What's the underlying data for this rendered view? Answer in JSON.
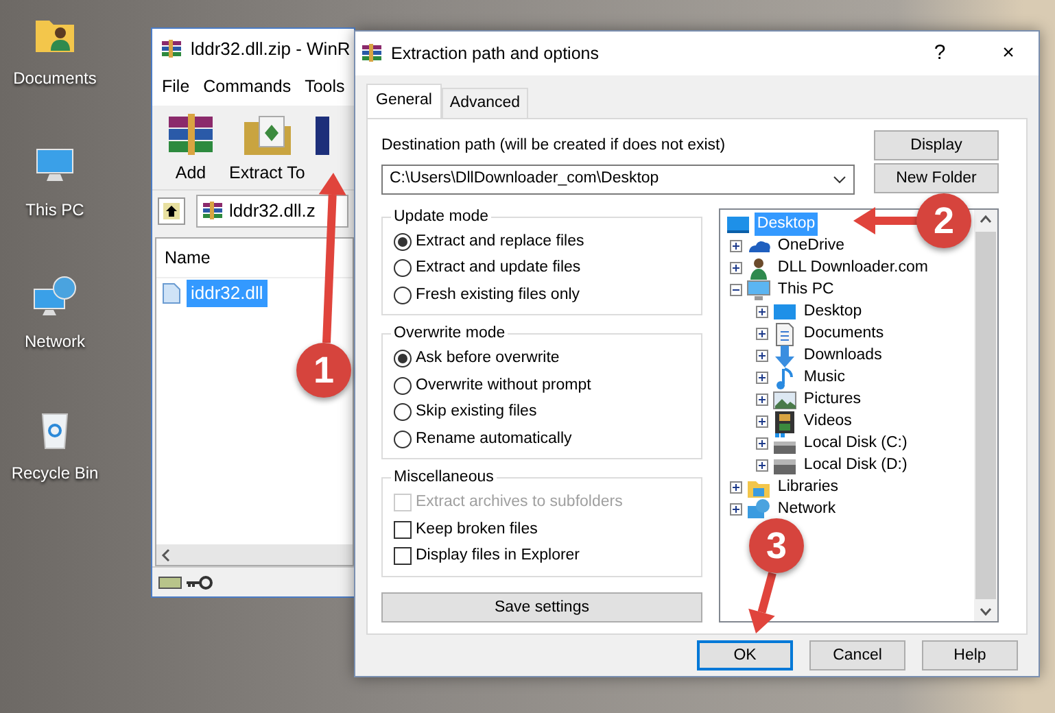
{
  "desktop": {
    "icons": [
      {
        "label": "Documents"
      },
      {
        "label": "This PC"
      },
      {
        "label": "Network"
      },
      {
        "label": "Recycle Bin"
      }
    ]
  },
  "archiver_window": {
    "title": "lddr32.dll.zip - WinR",
    "menu": [
      "File",
      "Commands",
      "Tools"
    ],
    "toolbar": [
      {
        "label": "Add"
      },
      {
        "label": "Extract To"
      }
    ],
    "path": "lddr32.dll.z",
    "list": {
      "columns": [
        "Name"
      ],
      "rows": [
        {
          "name": "iddr32.dll",
          "selected": true
        }
      ]
    }
  },
  "dialog": {
    "title": "Extraction path and options",
    "help": "?",
    "close": "×",
    "tabs": [
      {
        "label": "General",
        "selected": true
      },
      {
        "label": "Advanced",
        "selected": false
      }
    ],
    "destination": {
      "label": "Destination path (will be created if does not exist)",
      "value": "C:\\Users\\DllDownloader_com\\Desktop"
    },
    "side_buttons": [
      "Display",
      "New Folder"
    ],
    "groups": [
      {
        "title": "Update mode",
        "options": [
          {
            "kind": "radio",
            "label": "Extract and replace files",
            "checked": true,
            "disabled": false
          },
          {
            "kind": "radio",
            "label": "Extract and update files",
            "checked": false,
            "disabled": false
          },
          {
            "kind": "radio",
            "label": "Fresh existing files only",
            "checked": false,
            "disabled": false
          }
        ]
      },
      {
        "title": "Overwrite mode",
        "options": [
          {
            "kind": "radio",
            "label": "Ask before overwrite",
            "checked": true,
            "disabled": false
          },
          {
            "kind": "radio",
            "label": "Overwrite without prompt",
            "checked": false,
            "disabled": false
          },
          {
            "kind": "radio",
            "label": "Skip existing files",
            "checked": false,
            "disabled": false
          },
          {
            "kind": "radio",
            "label": "Rename automatically",
            "checked": false,
            "disabled": false
          }
        ]
      },
      {
        "title": "Miscellaneous",
        "options": [
          {
            "kind": "checkbox",
            "label": "Extract archives to subfolders",
            "checked": false,
            "disabled": true
          },
          {
            "kind": "checkbox",
            "label": "Keep broken files",
            "checked": false,
            "disabled": false
          },
          {
            "kind": "checkbox",
            "label": "Display files in Explorer",
            "checked": false,
            "disabled": false
          }
        ]
      }
    ],
    "save_button": "Save settings",
    "tree": [
      {
        "label": "Desktop",
        "selected": true,
        "children": [
          {
            "label": "OneDrive",
            "selected": false,
            "expanded": false
          },
          {
            "label": "DLL Downloader.com",
            "selected": false,
            "expanded": false
          },
          {
            "label": "This PC",
            "selected": false,
            "expanded": true,
            "children": [
              {
                "label": "Desktop",
                "selected": false,
                "expanded": false
              },
              {
                "label": "Documents",
                "selected": false,
                "expanded": false
              },
              {
                "label": "Downloads",
                "selected": false,
                "expanded": false
              },
              {
                "label": "Music",
                "selected": false,
                "expanded": false
              },
              {
                "label": "Pictures",
                "selected": false,
                "expanded": false
              },
              {
                "label": "Videos",
                "selected": false,
                "expanded": false
              },
              {
                "label": "Local Disk (C:)",
                "selected": false,
                "expanded": false
              },
              {
                "label": "Local Disk (D:)",
                "selected": false,
                "expanded": false
              }
            ]
          },
          {
            "label": "Libraries",
            "selected": false,
            "expanded": false
          },
          {
            "label": "Network",
            "selected": false,
            "expanded": false
          }
        ]
      }
    ],
    "buttons": [
      {
        "label": "OK",
        "default": true
      },
      {
        "label": "Cancel",
        "default": false
      },
      {
        "label": "Help",
        "default": false
      }
    ]
  },
  "annotations": [
    {
      "number": "1"
    },
    {
      "number": "2"
    },
    {
      "number": "3"
    }
  ]
}
